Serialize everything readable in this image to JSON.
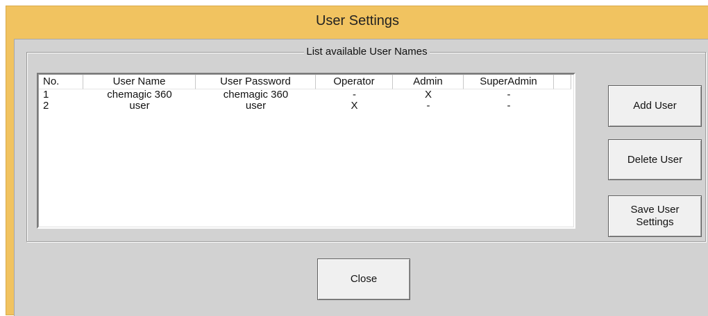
{
  "window": {
    "title": "User Settings"
  },
  "group": {
    "legend": "List available User Names"
  },
  "table": {
    "columns": [
      "No.",
      "User Name",
      "User Password",
      "Operator",
      "Admin",
      "SuperAdmin",
      ""
    ],
    "rows": [
      [
        "1",
        "chemagic 360",
        "chemagic 360",
        "-",
        "X",
        "-"
      ],
      [
        "2",
        "user",
        "user",
        "X",
        "-",
        "-"
      ]
    ]
  },
  "buttons": {
    "add_user": "Add User",
    "delete_user": "Delete User",
    "save_user_settings_line1": "Save User",
    "save_user_settings_line2": "Settings",
    "close": "Close"
  },
  "colors": {
    "title_bar": "#f1c360",
    "client_background": "#d2d2d2",
    "list_background": "#ffffff",
    "button_face": "#f0f0f0"
  }
}
